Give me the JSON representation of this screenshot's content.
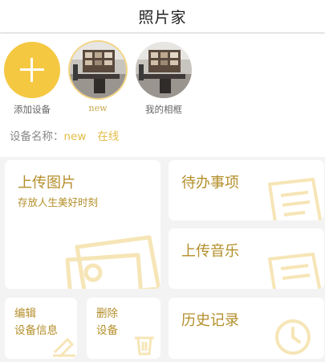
{
  "header": {
    "title": "照片家"
  },
  "devices": [
    {
      "label": "添加设备",
      "type": "add"
    },
    {
      "label": "new",
      "type": "frame",
      "selected": true
    },
    {
      "label": "我的相框",
      "type": "frame",
      "selected": false
    }
  ],
  "device_info": {
    "prefix": "设备名称：",
    "name": "new",
    "status": "在线"
  },
  "cards": {
    "upload_photo": {
      "title": "上传图片",
      "subtitle": "存放人生美好时刻",
      "icon": "photo-icon"
    },
    "todo": {
      "title": "待办事项",
      "icon": "document-icon"
    },
    "upload_music": {
      "title": "上传音乐",
      "icon": "music-icon"
    },
    "edit_device": {
      "line1": "编辑",
      "line2": "设备信息",
      "icon": "pencil-icon"
    },
    "delete_device": {
      "line1": "删除",
      "line2": "设备",
      "icon": "trash-icon"
    },
    "history": {
      "title": "历史记录",
      "icon": "clock-icon"
    }
  },
  "colors": {
    "accent": "#f5c842",
    "card_text": "#b38e2a",
    "status_text": "#e2bd45",
    "background": "#f3f3f3"
  }
}
